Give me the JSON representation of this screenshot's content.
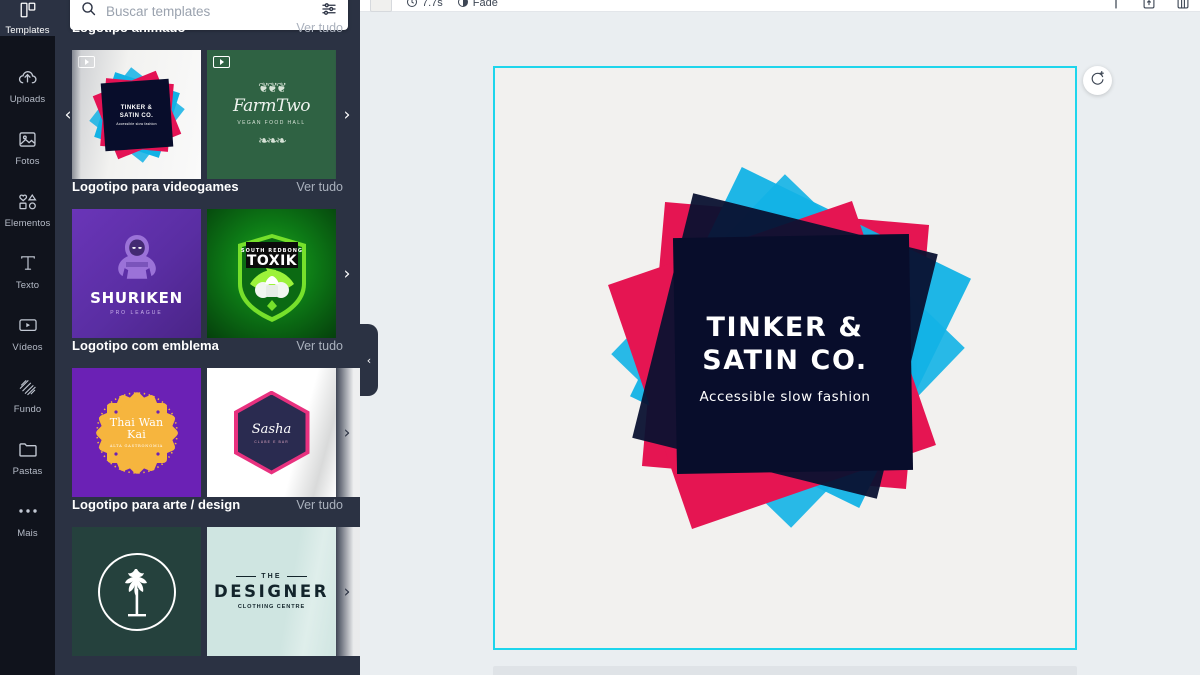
{
  "rail": {
    "active": {
      "label": "Templates",
      "icon": "templates-icon"
    },
    "items": [
      {
        "label": "Uploads",
        "icon": "upload-cloud-icon"
      },
      {
        "label": "Fotos",
        "icon": "photo-icon"
      },
      {
        "label": "Elementos",
        "icon": "shapes-icon"
      },
      {
        "label": "Texto",
        "icon": "text-t-icon"
      },
      {
        "label": "Vídeos",
        "icon": "video-icon"
      },
      {
        "label": "Fundo",
        "icon": "background-hatch-icon"
      },
      {
        "label": "Pastas",
        "icon": "folder-icon"
      },
      {
        "label": "Mais",
        "icon": "more-dots-icon"
      }
    ]
  },
  "search": {
    "placeholder": "Buscar templates",
    "value": "",
    "search_icon": "search-icon",
    "filter_icon": "filter-sliders-icon"
  },
  "panel": {
    "see_all_label": "Ver tudo",
    "prev_arrow": "‹",
    "next_arrow": "›",
    "collapse_arrow": "‹",
    "sections": [
      {
        "title": "Logotipo animado",
        "see_all": "Ver tudo",
        "cards": [
          {
            "name": "tinker-satin-animated",
            "brand": "TINKER &\nSATIN CO.",
            "tagline": "Accessible slow fashion",
            "video": true
          },
          {
            "name": "farmtwo-animated",
            "brand": "FarmTwo",
            "tagline": "VEGAN FOOD HALL",
            "video": true
          }
        ]
      },
      {
        "title": "Logotipo para videogames",
        "see_all": "Ver tudo",
        "cards": [
          {
            "name": "shuriken",
            "brand": "SHURIKEN",
            "tagline": "PRO LEAGUE",
            "video": false
          },
          {
            "name": "toxik",
            "brand": "TOXIK",
            "tagline": "SOUTH REDBONG",
            "video": false
          }
        ]
      },
      {
        "title": "Logotipo com emblema",
        "see_all": "Ver tudo",
        "cards": [
          {
            "name": "thai-wan-kai",
            "brand": "Thai Wan\nKai",
            "tagline": "ALTA GASTRONOMIA",
            "video": false
          },
          {
            "name": "sasha",
            "brand": "Sasha",
            "tagline": "CLUBE E BAR",
            "video": false
          }
        ]
      },
      {
        "title": "Logotipo para arte / design",
        "see_all": "Ver tudo",
        "cards": [
          {
            "name": "tree-emblem",
            "brand": "",
            "tagline": "",
            "video": false
          },
          {
            "name": "the-designer",
            "brand": "DESIGNER",
            "tagline": "CLOTHING CENTRE",
            "pretitle": "THE",
            "video": false
          }
        ]
      }
    ]
  },
  "topbar": {
    "duration": "7.7s",
    "transition": "Fade",
    "clock_icon": "clock-icon",
    "transition_icon": "transition-icon",
    "right_icons": [
      "position-icon",
      "upload-export-icon",
      "page-layout-icon"
    ]
  },
  "page_tools": {
    "note_icon": "note-icon",
    "duplicate_icon": "duplicate-page-icon",
    "add_page_icon": "add-page-icon"
  },
  "regenerate": {
    "icon": "regenerate-animation-icon"
  },
  "canvas": {
    "brand_line1": "TINKER &",
    "brand_line2": "SATIN CO.",
    "tagline": "Accessible slow fashion",
    "background": "#f2f1ef",
    "selection_color": "#1ed5ec",
    "colors": {
      "pink": "#e51552",
      "blue": "#12b2e5",
      "navy": "#080d2b",
      "text": "#ffffff"
    }
  }
}
